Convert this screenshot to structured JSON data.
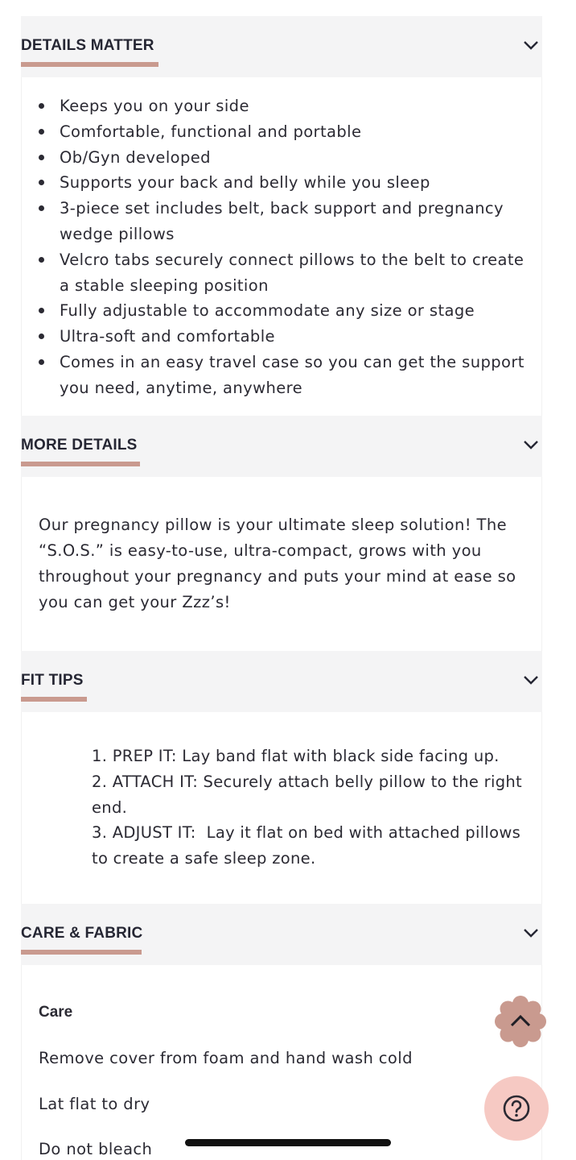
{
  "sections": {
    "details_matter": {
      "title": "DETAILS MATTER",
      "bullets": [
        "Keeps you on your side",
        "Comfortable, functional and portable",
        "Ob/Gyn developed",
        "Supports your back and belly while you sleep",
        "3-piece set includes belt, back support and pregnancy wedge pillows",
        "Velcro tabs securely connect pillows to the belt to create a stable sleeping position",
        "Fully adjustable to accommodate any size or stage",
        "Ultra-soft and comfortable",
        "Comes in an easy travel case so you can get the support you need, anytime, anywhere"
      ]
    },
    "more_details": {
      "title": "MORE DETAILS",
      "text": "Our pregnancy pillow is your ultimate sleep solution! The “S.O.S.” is easy-to-use, ultra-compact, grows with you throughout your pregnancy and puts your mind at ease so you can get your Zzz’s!"
    },
    "fit_tips": {
      "title": "FIT TIPS",
      "steps": [
        "1. PREP IT: Lay band flat with black side facing up.",
        "2. ATTACH IT: Securely attach belly pillow to the right end.",
        "3. ADJUST IT:  Lay it flat on bed with attached pillows to create a safe sleep zone."
      ]
    },
    "care_fabric": {
      "title": "CARE & FABRIC",
      "care_heading": "Care",
      "lines": [
        "Remove cover from foam and hand wash cold",
        "Lat flat to dry",
        "Do not bleach"
      ]
    }
  },
  "icons": {
    "accordion": "chevron-down-icon",
    "back_to_top": "chevron-up-icon",
    "help": "question-mark-icon"
  },
  "colors": {
    "accent_underline": "#c99a8f",
    "back_to_top_bg": "#c99a8f",
    "help_bg": "#f6c9c3",
    "header_bg": "#f4f4f5"
  }
}
